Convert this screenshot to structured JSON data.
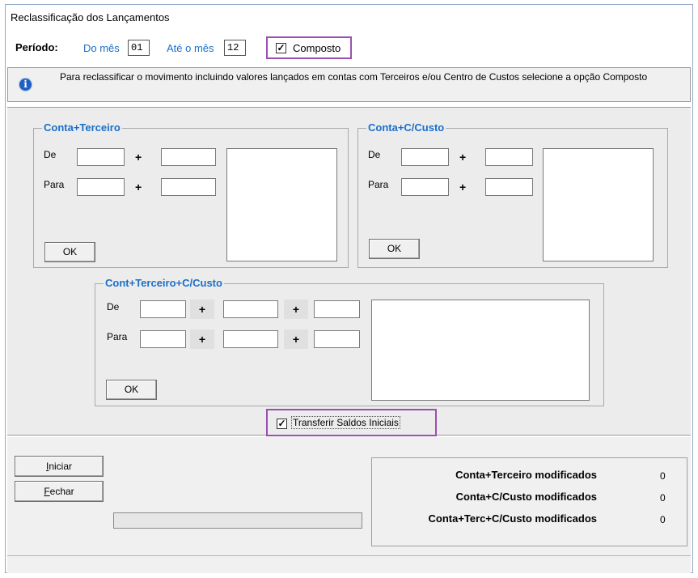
{
  "window": {
    "title": "Reclassificação dos Lançamentos"
  },
  "period": {
    "label": "Período:",
    "from_label": "Do mês",
    "from_value": "01",
    "to_label": "Até o mês",
    "to_value": "12",
    "composto_label": "Composto",
    "composto_checked": "✓"
  },
  "info": {
    "icon": "info-icon",
    "text": "Para reclassificar o movimento incluindo valores lançados em contas com Terceiros e/ou Centro de Custos selecione a opção Composto"
  },
  "groups": {
    "conta_terceiro": {
      "title": "Conta+Terceiro",
      "de_label": "De",
      "para_label": "Para",
      "plus": "+",
      "ok_label": "OK"
    },
    "conta_ccusto": {
      "title": "Conta+C/Custo",
      "de_label": "De",
      "para_label": "Para",
      "plus": "+",
      "ok_label": "OK"
    },
    "conta_terceiro_ccusto": {
      "title": "Cont+Terceiro+C/Custo",
      "de_label": "De",
      "para_label": "Para",
      "plus": "+",
      "ok_label": "OK"
    }
  },
  "transferir": {
    "label": "Transferir Saldos Iniciais",
    "checked": "✓"
  },
  "actions": {
    "iniciar_label": "Iniciar",
    "fechar_label": "Fechar"
  },
  "summary": [
    {
      "label": "Conta+Terceiro modificados",
      "value": "0"
    },
    {
      "label": "Conta+C/Custo modificados",
      "value": "0"
    },
    {
      "label": "Conta+Terc+C/Custo modificados",
      "value": "0"
    }
  ],
  "colors": {
    "accent": "#1a6fc9",
    "highlight": "#9b4fb0",
    "info_icon": "#1f5fc4"
  }
}
